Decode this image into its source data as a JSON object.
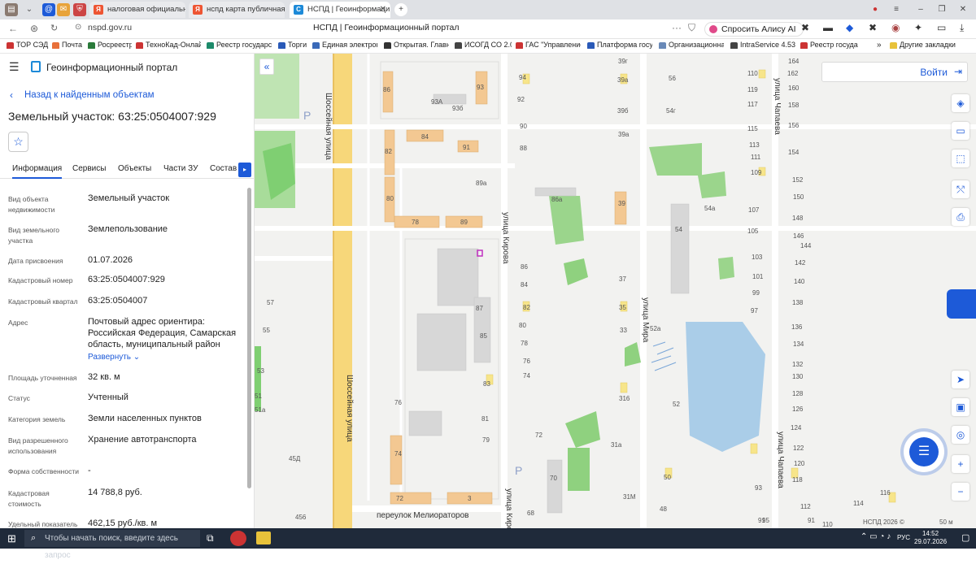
{
  "browser": {
    "tabs": [
      {
        "label": "налоговая официальный",
        "active": false
      },
      {
        "label": "нспд карта публичная ка",
        "active": false
      },
      {
        "label": "НСПД | Геоинформаци",
        "active": true
      }
    ],
    "url": "nspd.gov.ru",
    "page_title": "НСПД | Геоинформационный портал",
    "alisa": "Спросить Алису AI",
    "bookmarks": [
      "ТОР СЭД",
      "Почта",
      "Росреестр",
      "ТехноКад-Онлайн",
      "Реестр государст",
      "Торги",
      "Единая электрон",
      "Открытая. Главна",
      "ИСОГД СО 2.0",
      "ГАС \"Управление",
      "Платформа госуд",
      "Организационна",
      "IntraService 4.53.1",
      "Реестр госуда"
    ],
    "other_bookmarks": "Другие закладки"
  },
  "panel": {
    "title": "Геоинформационный портал",
    "back": "Назад к найденным объектам",
    "object_title": "Земельный участок: 63:25:0504007:929",
    "tabs": [
      "Информация",
      "Сервисы",
      "Объекты",
      "Части ЗУ",
      "Состав"
    ],
    "fields": [
      {
        "label": "Вид объекта недвижимости",
        "value": "Земельный участок"
      },
      {
        "label": "Вид земельного участка",
        "value": "Землепользование"
      },
      {
        "label": "Дата присвоения",
        "value": "01.07.2026"
      },
      {
        "label": "Кадастровый номер",
        "value": "63:25:0504007:929"
      },
      {
        "label": "Кадастровый квартал",
        "value": "63:25:0504007"
      },
      {
        "label": "Адрес",
        "value": "Почтовый адрес ориентира: Российская Федерация, Самарская область, муниципальный район"
      },
      {
        "label": "Площадь уточненная",
        "value": "32 кв. м"
      },
      {
        "label": "Статус",
        "value": "Учтенный"
      },
      {
        "label": "Категория земель",
        "value": "Земли населенных пунктов"
      },
      {
        "label": "Вид разрешенного использования",
        "value": "Хранение автотранспорта"
      },
      {
        "label": "Форма собственности",
        "value": "-"
      },
      {
        "label": "Кадастровая стоимость",
        "value": "14 788,8 руб."
      },
      {
        "label": "Удельный показатель",
        "value": "462,15 руб./кв. м"
      }
    ],
    "expand": "Развернуть"
  },
  "map": {
    "login": "Войти",
    "streets": [
      "Шоссейная улица",
      "Шоссейная улица",
      "улица Кирова",
      "улица Кирова",
      "улица Мира",
      "улица Чапаева",
      "улица Чапаева",
      "переулок Мелиораторов"
    ],
    "house_numbers": [
      "86",
      "93",
      "93А",
      "93б",
      "84",
      "91",
      "82",
      "89а",
      "80",
      "78",
      "89",
      "94",
      "92",
      "90",
      "88",
      "86а",
      "39",
      "39г",
      "39а",
      "39б",
      "39а",
      "56",
      "54г",
      "54а",
      "54",
      "86",
      "84",
      "82",
      "80",
      "78",
      "76",
      "74",
      "87",
      "85",
      "83",
      "81",
      "79",
      "76",
      "74",
      "72",
      "72",
      "70",
      "3",
      "37",
      "35",
      "33",
      "316",
      "31а",
      "31М",
      "50",
      "48",
      "68",
      "57",
      "55",
      "53",
      "51",
      "51а",
      "45Д",
      "456",
      "52а",
      "52",
      "93",
      "91",
      "164",
      "162",
      "160",
      "158",
      "156",
      "154",
      "152",
      "150",
      "148",
      "146",
      "144",
      "142",
      "140",
      "138",
      "136",
      "134",
      "132",
      "130",
      "128",
      "126",
      "124",
      "122",
      "120",
      "118",
      "116",
      "114",
      "112",
      "110",
      "119",
      "117",
      "115",
      "113",
      "111",
      "109",
      "107",
      "105",
      "103",
      "101",
      "99",
      "97",
      "95",
      "91",
      "110",
      "89"
    ],
    "copyright": "НСПД 2026 ©",
    "scale": "50 м"
  },
  "taskbar": {
    "search_placeholder": "Чтобы начать поиск, введите здесь запрос",
    "lang": "РУС",
    "time": "14:52",
    "date": "29.07.2026"
  }
}
